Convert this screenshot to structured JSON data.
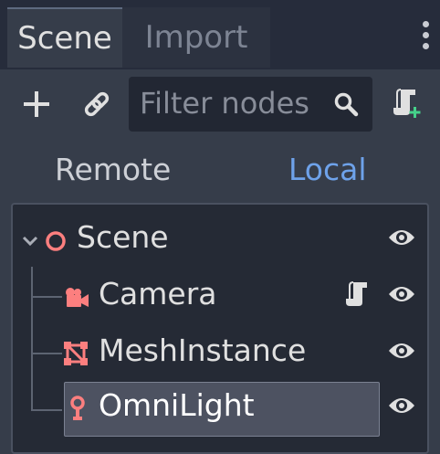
{
  "tabs": [
    {
      "label": "Scene",
      "active": true
    },
    {
      "label": "Import",
      "active": false
    }
  ],
  "toolbar": {
    "add_icon": "plus-icon",
    "instance_icon": "link-icon",
    "filter": {
      "placeholder": "Filter nodes",
      "value": ""
    },
    "search_icon": "search-icon",
    "script_icon": "add-script-icon"
  },
  "mode_switch": {
    "remote_label": "Remote",
    "local_label": "Local",
    "active": "Local"
  },
  "tree": {
    "nodes": [
      {
        "name": "Scene",
        "icon": "spatial-icon",
        "expanded": true,
        "visible": true
      },
      {
        "name": "Camera",
        "icon": "camera-icon",
        "has_script": true,
        "visible": true
      },
      {
        "name": "MeshInstance",
        "icon": "mesh-instance-icon",
        "visible": true
      },
      {
        "name": "OmniLight",
        "icon": "omni-light-icon",
        "selected": true,
        "visible": true
      }
    ]
  },
  "colors": {
    "panel_bg": "#363d4a",
    "tree_bg": "#252a35",
    "accent": "#6ea2ea",
    "node_icon": "#fc7f7f"
  }
}
